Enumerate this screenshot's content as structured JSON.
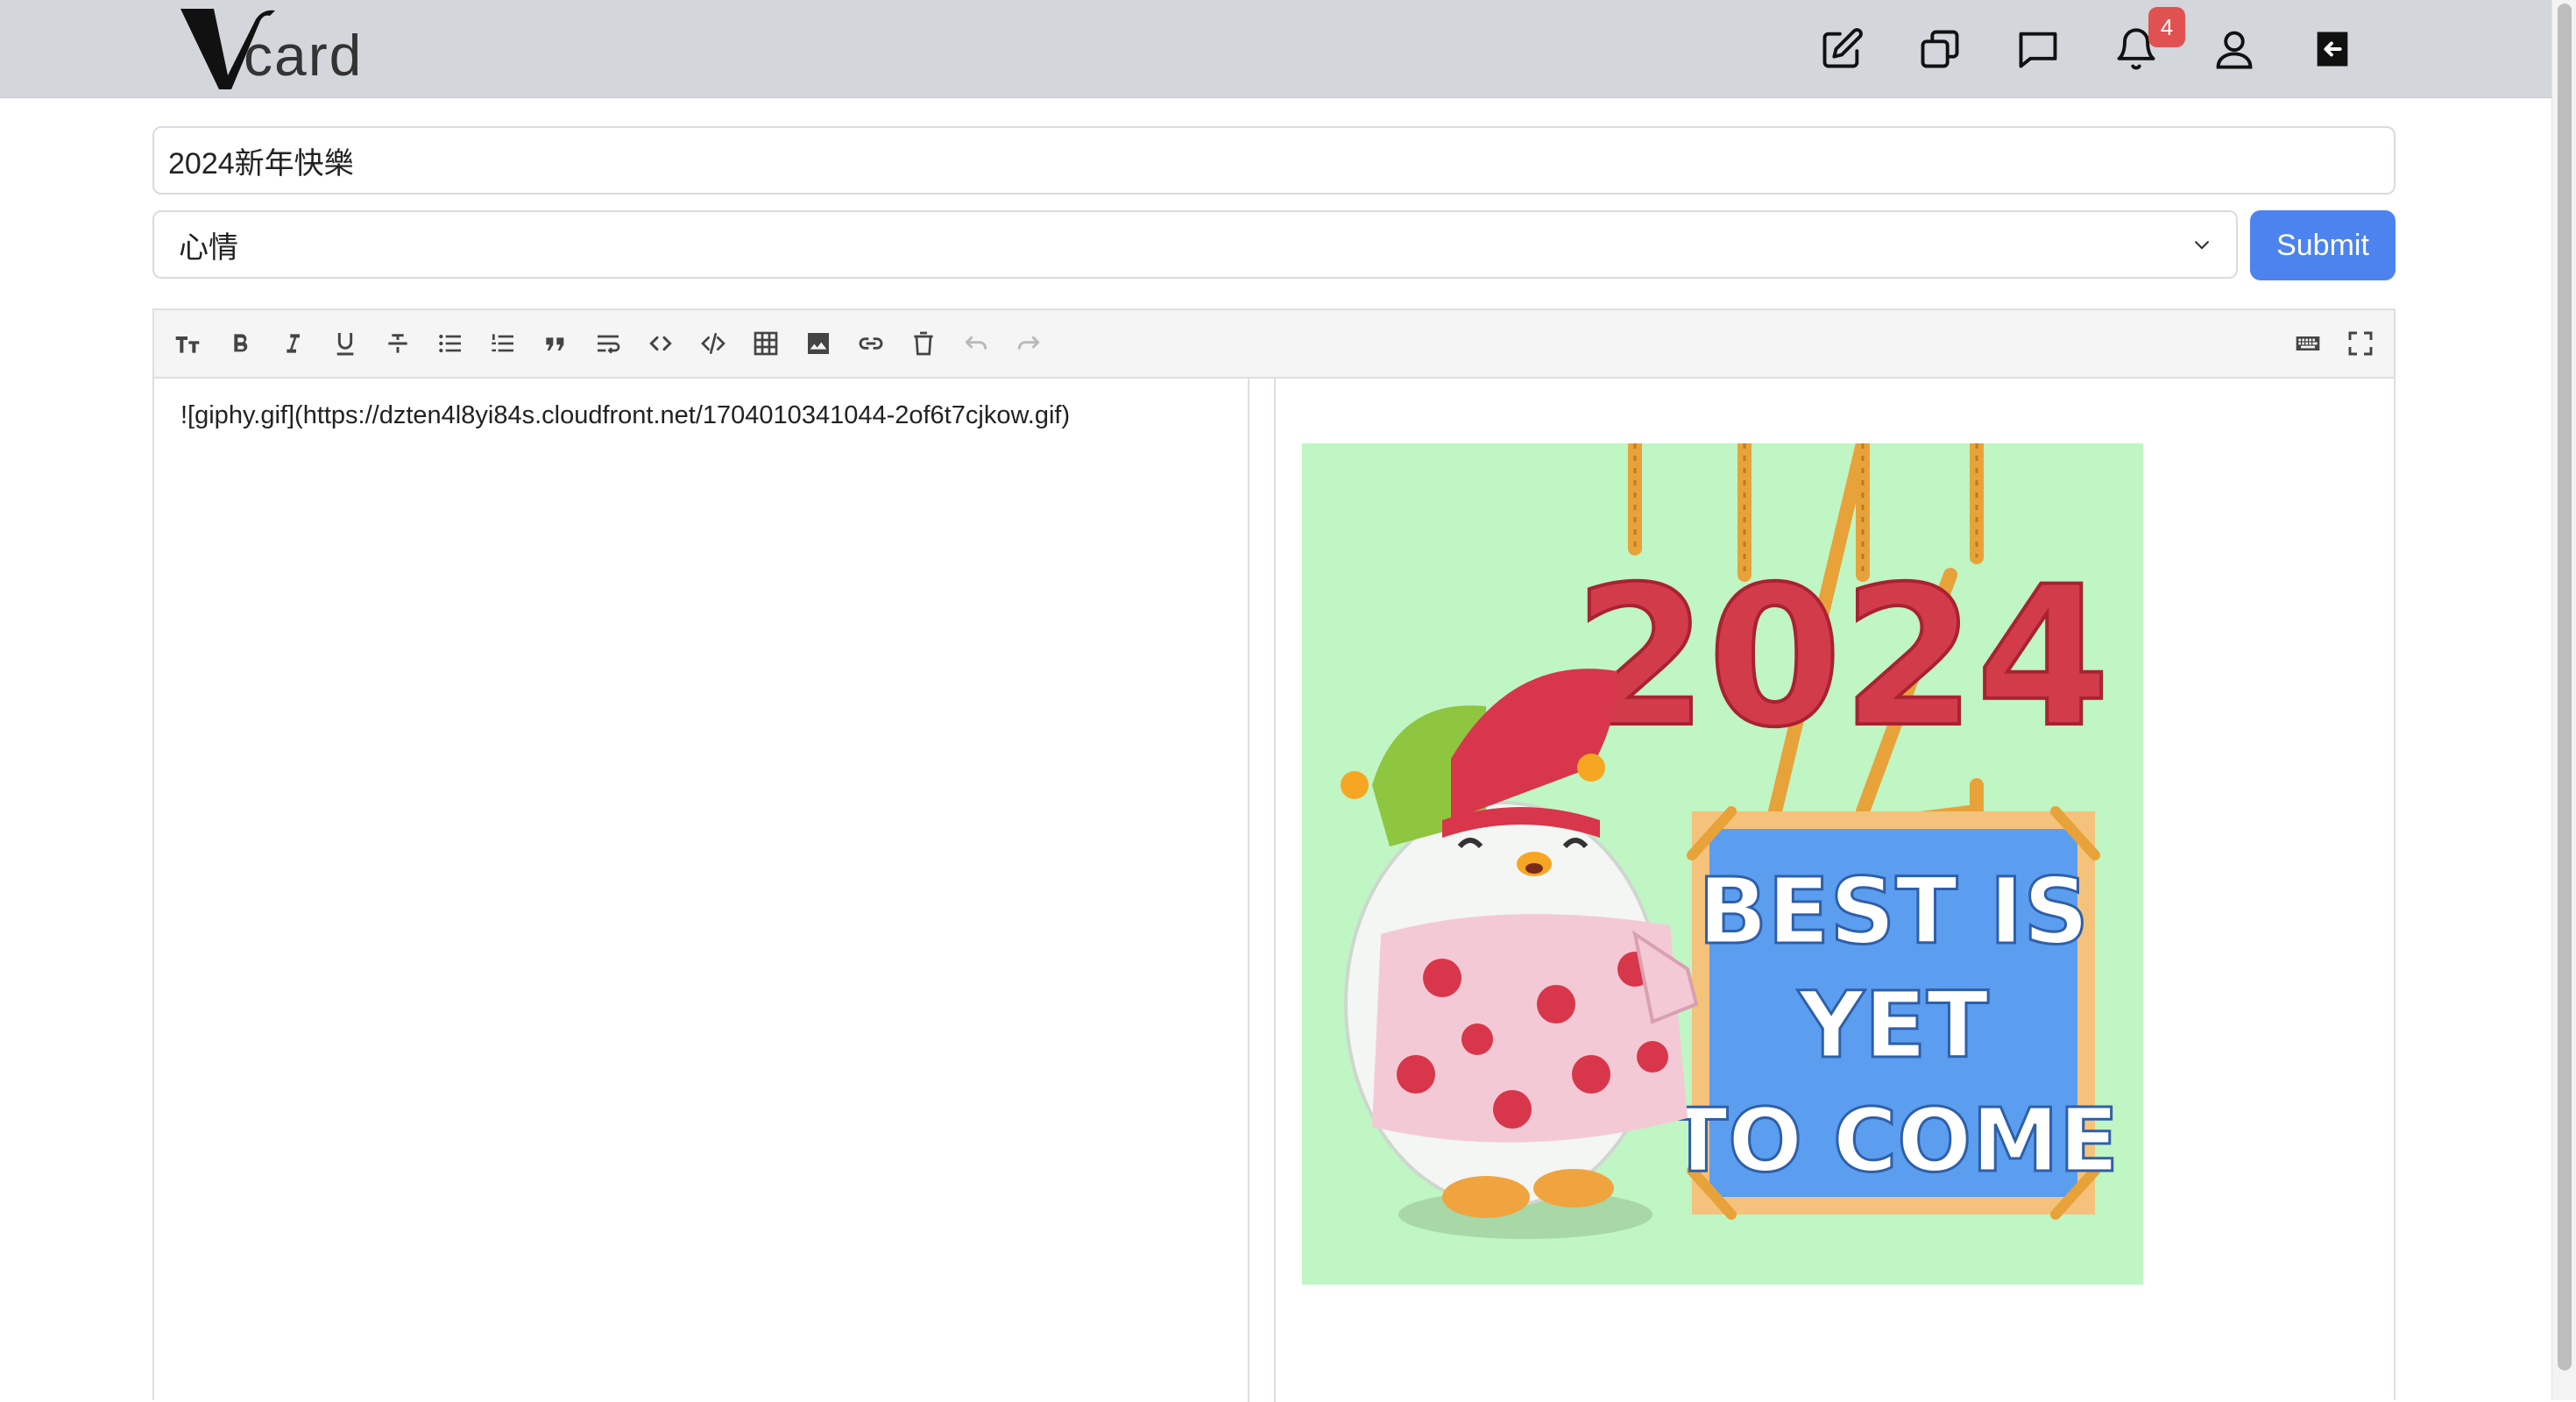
{
  "header": {
    "logo_text": "card",
    "icons": [
      "edit-icon",
      "copy-icon",
      "message-icon",
      "bell-icon",
      "user-icon",
      "logout-icon"
    ],
    "notification_count": "4",
    "colors": {
      "bar": "#d3d6db",
      "badge": "#e05252"
    }
  },
  "form": {
    "title_value": "2024新年快樂",
    "category_value": "心情",
    "submit_label": "Submit",
    "accent": "#4c83ee"
  },
  "editor": {
    "toolbar": [
      "heading-icon",
      "bold-icon",
      "italic-icon",
      "underline-icon",
      "strikethrough-icon",
      "bullet-list-icon",
      "ordered-list-icon",
      "quote-icon",
      "wrap-icon",
      "inline-code-icon",
      "code-block-icon",
      "table-icon",
      "image-icon",
      "link-icon",
      "clear-icon",
      "undo-icon",
      "redo-icon",
      "keyboard-icon",
      "fullscreen-icon"
    ],
    "markdown": "![giphy.gif](https://dzten4l8yi84s.cloudfront.net/1704010341044-2of6t7cjkow.gif)",
    "preview": {
      "alt": "giphy.gif",
      "year_text": "2024",
      "sign_lines": [
        "BEST IS",
        "YET",
        "TO COME"
      ],
      "bg": "#c0f5c4",
      "sign_color": "#5b9ef0"
    }
  }
}
